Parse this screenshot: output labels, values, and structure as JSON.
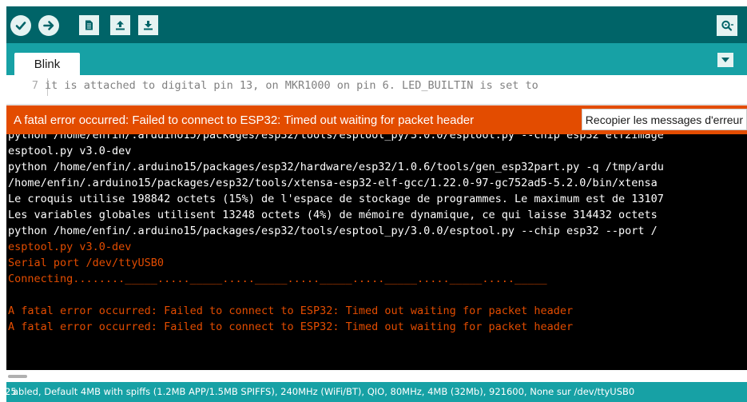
{
  "toolbar": {
    "buttons": [
      "verify-icon",
      "upload-icon",
      "new-icon",
      "open-icon",
      "save-icon"
    ],
    "right_button": "serial-monitor-icon",
    "colors": {
      "background": "#006468",
      "button": "#e5f3f2"
    }
  },
  "tabs": [
    {
      "label": "Blink"
    }
  ],
  "editor": {
    "line_number": "7",
    "line_text": "it is attached to digital pin 13, on MKR1000 on pin 6. LED_BUILTIN is set to"
  },
  "status": {
    "message": "A fatal error occurred: Failed to connect to ESP32: Timed out waiting for packet header",
    "copy_button": "Recopier les messages d'erreur",
    "color": "#e34c00"
  },
  "console": {
    "lines": [
      {
        "text": "python /home/enfin/.arduino15/packages/esp32/tools/esptool_py/3.0.0/esptool.py --chip esp32 elf2image",
        "kind": "white"
      },
      {
        "text": "esptool.py v3.0-dev",
        "kind": "white"
      },
      {
        "text": "python /home/enfin/.arduino15/packages/esp32/hardware/esp32/1.0.6/tools/gen_esp32part.py -q /tmp/ardu",
        "kind": "white"
      },
      {
        "text": "/home/enfin/.arduino15/packages/esp32/tools/xtensa-esp32-elf-gcc/1.22.0-97-gc752ad5-5.2.0/bin/xtensa",
        "kind": "white"
      },
      {
        "text": "Le croquis utilise 198842 octets (15%) de l'espace de stockage de programmes. Le maximum est de 13107",
        "kind": "white"
      },
      {
        "text": "Les variables globales utilisent 13248 octets (4%) de mémoire dynamique, ce qui laisse 314432 octets",
        "kind": "white"
      },
      {
        "text": "python /home/enfin/.arduino15/packages/esp32/tools/esptool_py/3.0.0/esptool.py --chip esp32 --port /",
        "kind": "white"
      },
      {
        "text": "esptool.py v3.0-dev",
        "kind": "orange"
      },
      {
        "text": "Serial port /dev/ttyUSB0",
        "kind": "orange"
      },
      {
        "text": "Connecting........_____....._____....._____....._____....._____....._____....._____",
        "kind": "orange"
      },
      {
        "text": "",
        "kind": "orange"
      },
      {
        "text": "A fatal error occurred: Failed to connect to ESP32: Timed out waiting for packet header",
        "kind": "orange"
      },
      {
        "text": "A fatal error occurred: Failed to connect to ESP32: Timed out waiting for packet header",
        "kind": "orange"
      }
    ]
  },
  "footer": {
    "line_number": "25",
    "board": "abled, Default 4MB with spiffs (1.2MB APP/1.5MB SPIFFS), 240MHz (WiFi/BT), QIO, 80MHz, 4MB (32Mb), 921600, None sur /dev/ttyUSB0"
  }
}
